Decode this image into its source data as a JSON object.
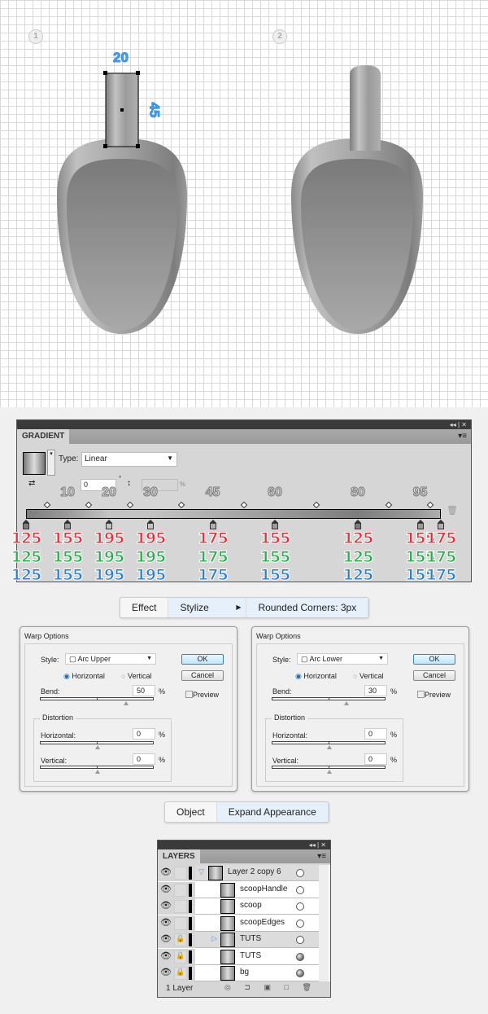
{
  "artwork": {
    "steps": [
      "1",
      "2"
    ],
    "dimensions": {
      "width": "20",
      "height": "45"
    }
  },
  "gradient_panel": {
    "title": "GRADIENT",
    "type_label": "Type:",
    "type_value": "Linear",
    "angle_value": "0",
    "degree_symbol": "°",
    "aspect_unit": "%",
    "stops": [
      {
        "location": 0,
        "rgb": [
          125,
          125,
          125
        ]
      },
      {
        "location": 10,
        "rgb": [
          155,
          155,
          155
        ]
      },
      {
        "location": 20,
        "rgb": [
          195,
          195,
          195
        ]
      },
      {
        "location": 30,
        "rgb": [
          195,
          195,
          195
        ]
      },
      {
        "location": 45,
        "rgb": [
          175,
          175,
          175
        ]
      },
      {
        "location": 60,
        "rgb": [
          155,
          155,
          155
        ]
      },
      {
        "location": 80,
        "rgb": [
          125,
          125,
          125
        ]
      },
      {
        "location": 95,
        "rgb": [
          155,
          155,
          155
        ]
      },
      {
        "location": 100,
        "rgb": [
          175,
          175,
          175
        ]
      }
    ],
    "location_labels": [
      "10",
      "20",
      "30",
      "45",
      "60",
      "80",
      "95"
    ],
    "r_values": [
      "125",
      "155",
      "195",
      "195",
      "175",
      "155",
      "125",
      "155",
      "175"
    ],
    "g_values": [
      "125",
      "155",
      "195",
      "195",
      "175",
      "155",
      "125",
      "155",
      "175"
    ],
    "b_values": [
      "125",
      "155",
      "195",
      "195",
      "175",
      "155",
      "125",
      "155",
      "175"
    ],
    "colors": {
      "red": "#e0303c",
      "green": "#2fa84f",
      "blue": "#2f7fc8"
    }
  },
  "effect_breadcrumb": [
    "Effect",
    "Stylize",
    "Rounded Corners: 3px"
  ],
  "warp_dialogs": [
    {
      "title": "Warp Options",
      "style_label": "Style:",
      "style": "Arc Upper",
      "horizontal": "Horizontal",
      "vertical": "Vertical",
      "bend_label": "Bend:",
      "bend": "50",
      "distortion": "Distortion",
      "h_label": "Horizontal:",
      "h_value": "0",
      "v_label": "Vertical:",
      "v_value": "0",
      "pct": "%",
      "ok": "OK",
      "cancel": "Cancel",
      "preview": "Preview",
      "bend_fraction": 0.75
    },
    {
      "title": "Warp Options",
      "style_label": "Style:",
      "style": "Arc Lower",
      "horizontal": "Horizontal",
      "vertical": "Vertical",
      "bend_label": "Bend:",
      "bend": "30",
      "distortion": "Distortion",
      "h_label": "Horizontal:",
      "h_value": "0",
      "v_label": "Vertical:",
      "v_value": "0",
      "pct": "%",
      "ok": "OK",
      "cancel": "Cancel",
      "preview": "Preview",
      "bend_fraction": 0.65
    }
  ],
  "object_breadcrumb": [
    "Object",
    "Expand Appearance"
  ],
  "layers_panel": {
    "title": "LAYERS",
    "rows": [
      {
        "name": "Layer 2 copy 6",
        "locked": false
      },
      {
        "name": "scoopHandle",
        "locked": false
      },
      {
        "name": "scoop",
        "locked": false
      },
      {
        "name": "scoopEdges",
        "locked": false
      },
      {
        "name": "TUTS",
        "locked": true
      },
      {
        "name": "TUTS",
        "locked": true
      },
      {
        "name": "bg",
        "locked": true
      }
    ],
    "footer": "1 Layer"
  }
}
